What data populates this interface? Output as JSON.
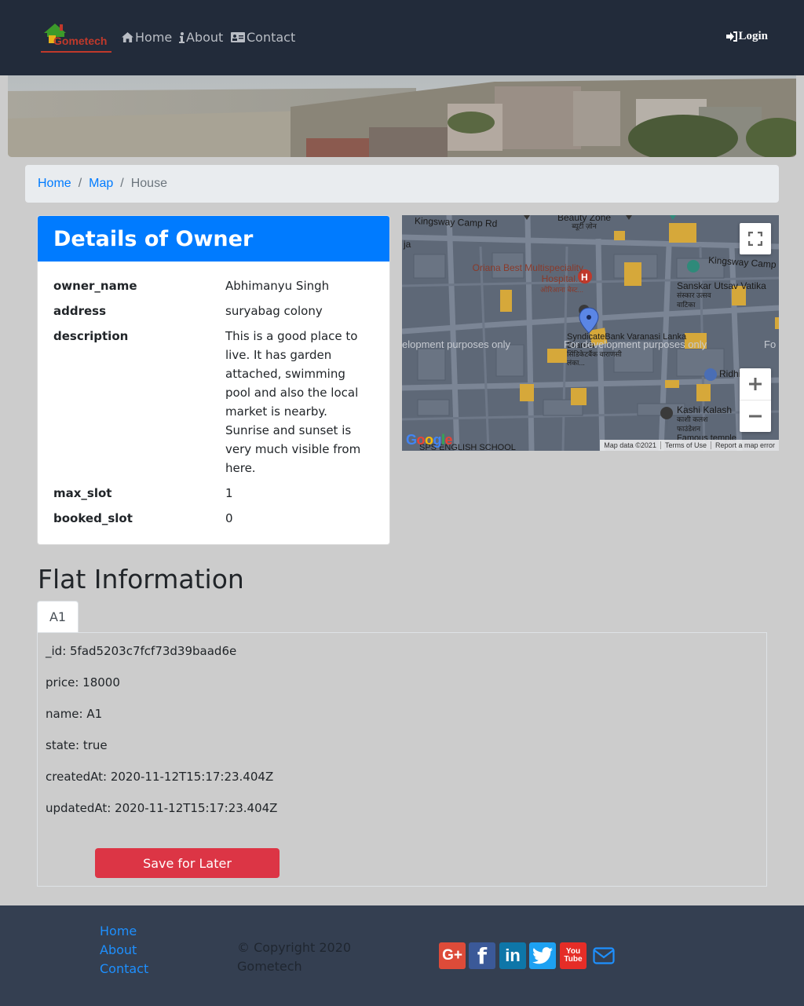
{
  "navbar": {
    "logo_text": "Gometech",
    "links": [
      {
        "label": "Home",
        "icon": "home-icon"
      },
      {
        "label": "About",
        "icon": "info-icon"
      },
      {
        "label": "Contact",
        "icon": "address-card-icon"
      }
    ],
    "login_label": "Login",
    "login_icon": "sign-in-icon"
  },
  "breadcrumb": {
    "items": [
      "Home",
      "Map"
    ],
    "active": "House"
  },
  "owner_card": {
    "title": "Details of Owner",
    "fields": [
      {
        "key": "owner_name",
        "value": "Abhimanyu Singh"
      },
      {
        "key": "address",
        "value": "suryabag colony"
      },
      {
        "key": "description",
        "value": "This is a good place to live. It has garden attached, swimming pool and also the local market is nearby. Sunrise and sunset is very much visible from here."
      },
      {
        "key": "max_slot",
        "value": "1"
      },
      {
        "key": "booked_slot",
        "value": "0"
      }
    ]
  },
  "map": {
    "labels": {
      "road1": "Kingsway Camp Rd",
      "road2": "Kingsway Camp",
      "beauty": "Beauty Zone",
      "beauty_hi": "ब्यूटी ज़ोन",
      "hospital": "Oriana Best Multispeciality Hospital...",
      "hospital_hi": "ओरिआना बेस्ट...",
      "sanskar": "Sanskar Utsav Vatika",
      "sanskar_hi": "संस्कार उत्सव वाटिका",
      "bank": "SyndicateBank Varanasi Lanka Branch",
      "bank_hi": "सिंडिकेटबैंक वाराणसी लंका...",
      "dev_left": "elopment purposes only",
      "dev_mid": "For development purposes only",
      "dev_right": "Fo",
      "ridhi": "Ridhi",
      "kashi": "Kashi Kalash",
      "kashi_hi": "काशी कलश फाउंडेशन",
      "famous": "Famous temple",
      "school": "SPS ENGLISH SCHOOL",
      "ja": "ja"
    },
    "attribution": [
      "Map data ©2021",
      "Terms of Use",
      "Report a map error"
    ],
    "google": "Google"
  },
  "flat": {
    "title": "Flat Information",
    "tabs": [
      "A1"
    ],
    "fields": [
      "_id: 5fad5203c7fcf73d39baad6e",
      "price: 18000",
      "name: A1",
      "state: true",
      "createdAt: 2020-11-12T15:17:23.404Z",
      "updatedAt: 2020-11-12T15:17:23.404Z"
    ],
    "save_label": "Save for Later"
  },
  "footer": {
    "links": [
      "Home",
      "About",
      "Contact"
    ],
    "copyright": "© Copyright 2020 Gometech",
    "social": [
      {
        "name": "google-plus-icon",
        "color": "#dd4b39",
        "glyph": "G+"
      },
      {
        "name": "facebook-icon",
        "color": "#3b5998",
        "glyph": "f"
      },
      {
        "name": "linkedin-icon",
        "color": "#0e76a8",
        "glyph": "in"
      },
      {
        "name": "twitter-icon",
        "color": "#1da1f2",
        "glyph": "t"
      },
      {
        "name": "youtube-icon",
        "color": "#e52d27",
        "glyph": "You Tube"
      },
      {
        "name": "mail-icon",
        "color": "#1e90ff",
        "glyph": ""
      }
    ]
  },
  "colors": {
    "navbar": "#222b3a",
    "primary": "#007bff",
    "danger": "#dc3545",
    "footer": "#343f51",
    "page_bg": "#cccccc"
  }
}
